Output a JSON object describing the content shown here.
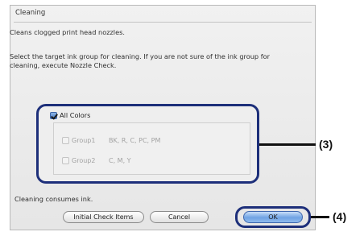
{
  "dialog": {
    "title": "Cleaning",
    "description": "Cleans clogged print head nozzles.",
    "instructions": "Select the target ink group for cleaning. If you are not sure of the ink group for cleaning, execute Nozzle Check.",
    "all_colors": {
      "label": "All Colors",
      "checked": true
    },
    "groups": [
      {
        "label": "Group1",
        "inks": "BK, R, C, PC, PM",
        "enabled": false
      },
      {
        "label": "Group2",
        "inks": "C, M, Y",
        "enabled": false
      }
    ],
    "note": "Cleaning consumes ink.",
    "buttons": {
      "initial_check": "Initial Check Items",
      "cancel": "Cancel",
      "ok": "OK"
    }
  },
  "callouts": {
    "group_box": "(3)",
    "ok_button": "(4)"
  },
  "colors": {
    "highlight": "#1d2f7a",
    "ok_button": "#6fa2e3"
  }
}
